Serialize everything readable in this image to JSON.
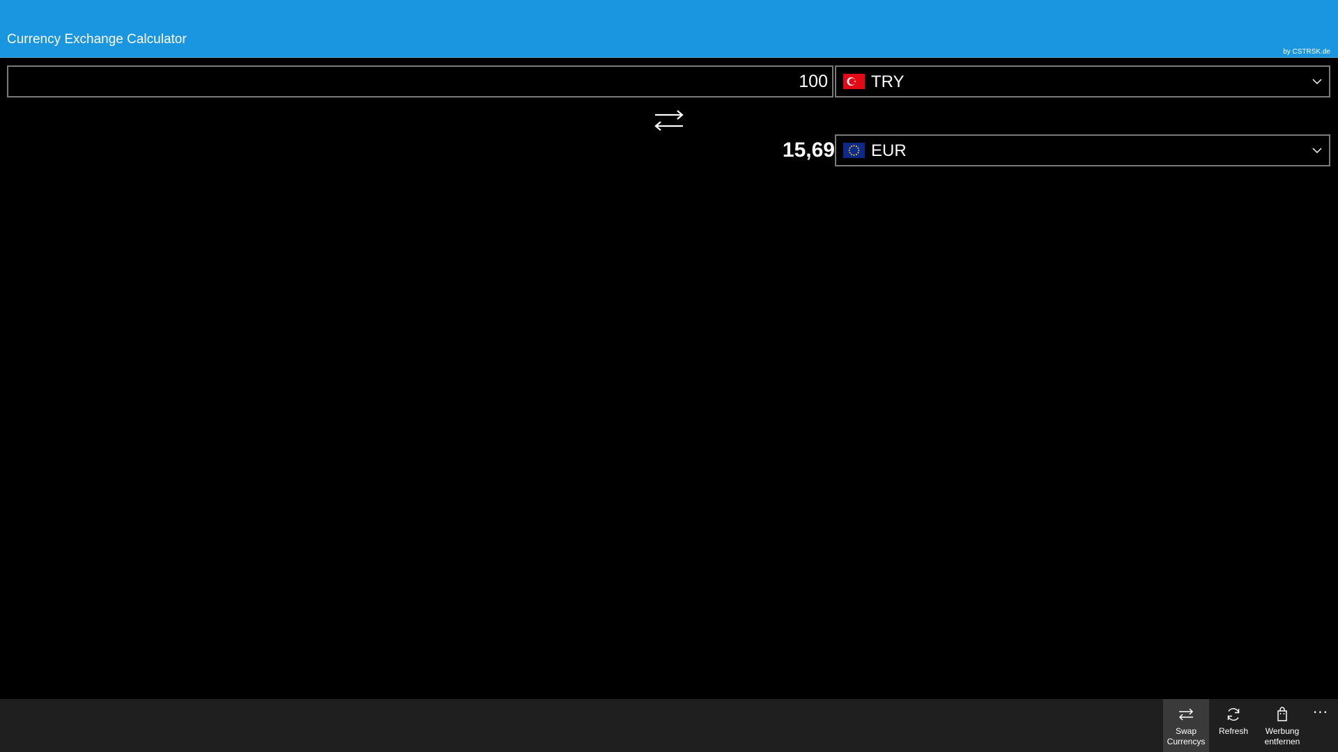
{
  "header": {
    "title": "Currency Exchange Calculator",
    "byline": "by CSTRSK.de",
    "background_color": "#1a96e0"
  },
  "converter": {
    "amount_value": "100",
    "from_currency": {
      "code": "TRY",
      "flag_icon": "turkey-flag-icon"
    },
    "to_currency": {
      "code": "EUR",
      "flag_icon": "eu-flag-icon"
    },
    "swap_icon": "swap-arrows-icon",
    "result": "15,69"
  },
  "app_bar": {
    "buttons": [
      {
        "label": "Swap\nCurrencys",
        "icon": "swap-icon",
        "active": true
      },
      {
        "label": "Refresh",
        "icon": "refresh-icon",
        "active": false
      },
      {
        "label": "Werbung\nentfernen",
        "icon": "shopping-bag-icon",
        "active": false
      }
    ],
    "more_label": "···",
    "background_color": "#1f1f1f"
  }
}
